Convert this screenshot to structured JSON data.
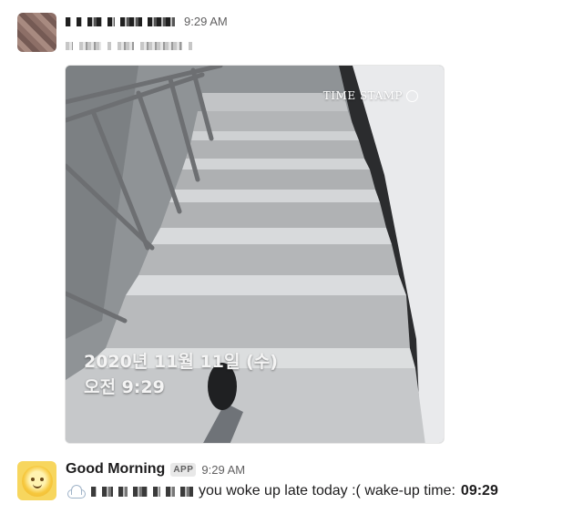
{
  "message1": {
    "timestamp": "9:29 AM",
    "photo": {
      "date_stamp": "2020년 11월 11일 (수)",
      "time_stamp": "오전 9:29",
      "logo_text": "TIME STAMP"
    }
  },
  "message2": {
    "sender": "Good Morning",
    "badge": "APP",
    "timestamp": "9:29 AM",
    "text": "you woke up late today :(  wake-up time:",
    "wake_time": "09:29",
    "icon": "cloud-icon"
  }
}
